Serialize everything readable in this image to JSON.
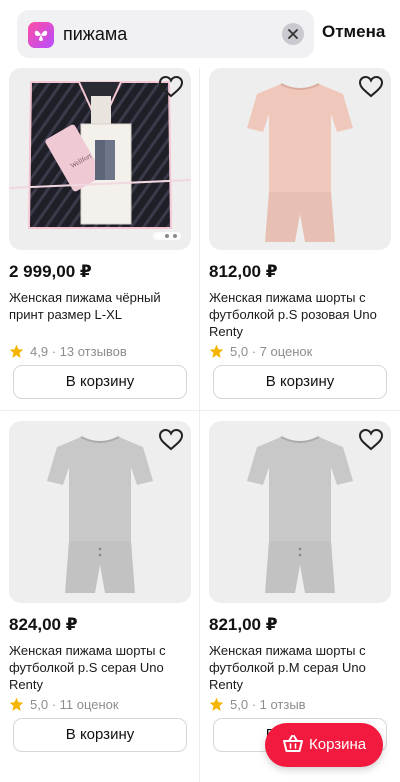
{
  "search": {
    "query": "пижама",
    "cancel_label": "Отмена"
  },
  "products": [
    {
      "price": "2 999,00 ₽",
      "title": "Женская пижама чёрный принт размер L-XL",
      "rating": "4,9",
      "reviews": "13 отзывов",
      "button": "В корзину",
      "brand_tag": "Wellfort",
      "image": "black-patterned-pajama-in-box"
    },
    {
      "price": "812,00 ₽",
      "title": "Женская пижама шорты с футболкой р.S розовая Uno Renty",
      "rating": "5,0",
      "reviews": "7 оценок",
      "button": "В корзину",
      "image": "pink-tshirt-shorts-set"
    },
    {
      "price": "824,00 ₽",
      "title": "Женская пижама шорты с футболкой р.S серая Uno Renty",
      "rating": "5,0",
      "reviews": "11 оценок",
      "button": "В корзину",
      "image": "gray-tshirt-shorts-set"
    },
    {
      "price": "821,00 ₽",
      "title": "Женская пижама шорты с футболкой р.M серая Uno Renty",
      "rating": "5,0",
      "reviews": "1 отзыв",
      "button": "В корзину",
      "image": "gray-tshirt-shorts-set"
    }
  ],
  "floating_cart": {
    "label": "Корзина"
  },
  "colors": {
    "accent": "#f21b3f",
    "star": "#f5b400",
    "placeholder_bg": "#eeeeee"
  },
  "icons": [
    "app-logo-icon",
    "clear-icon",
    "heart-icon",
    "star-icon",
    "basket-icon"
  ]
}
